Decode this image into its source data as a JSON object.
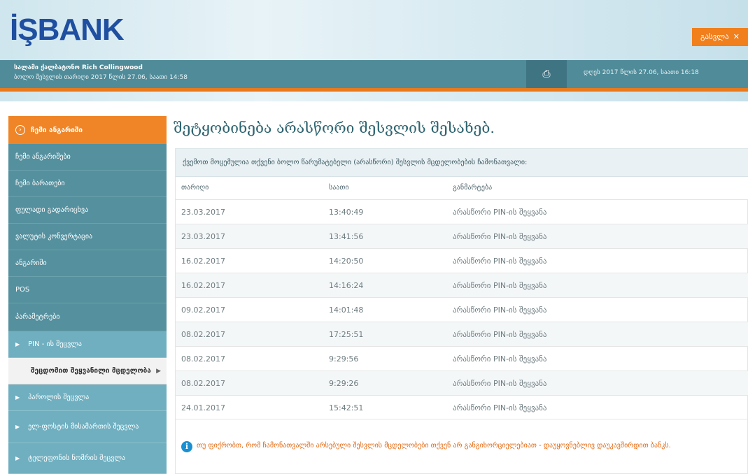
{
  "header": {
    "logo": "İŞBANK",
    "logout_label": "გასვლა",
    "user_line": "სალამი ქალბატონო Rich Collingwood",
    "last_login": "ბოლო შესვლის თარიღი 2017 წლის 27.06, საათი 14:58",
    "date_time": "დღეს 2017 წლის 27.06, საათი 16:18"
  },
  "sidebar": {
    "active": "ჩემი ანგარიში",
    "items": [
      "ჩემი ანგარიშები",
      "ჩემი ბარათები",
      "ფულადი გადარიცხვა",
      "ვალუტის კონვერტაცია",
      "ანგარიში",
      "POS",
      "პარამეტრები"
    ],
    "sub_items": [
      "PIN - ის შეცვლა",
      "შეცდომით შეყვანილი მცდელობა",
      "პაროლის შეცვლა",
      "ელ-ფოსტის მისამართის შეცვლა",
      "ტელეფონის ნომრის შეცვლა"
    ]
  },
  "main": {
    "title": "შეტყობინება არასწორი შესვლის შესახებ.",
    "subtitle": "ქვემოთ მოცემულია თქვენი ბოლო წარუმატებელი (არასწორი) შესვლის მცდელობების ჩამონათვალი:",
    "columns": [
      "თარიღი",
      "საათი",
      "განმარტება"
    ],
    "rows": [
      [
        "23.03.2017",
        "13:40:49",
        "არასწორი PIN-ის შეყვანა"
      ],
      [
        "23.03.2017",
        "13:41:56",
        "არასწორი PIN-ის შეყვანა"
      ],
      [
        "16.02.2017",
        "14:20:50",
        "არასწორი PIN-ის შეყვანა"
      ],
      [
        "16.02.2017",
        "14:16:24",
        "არასწორი PIN-ის შეყვანა"
      ],
      [
        "09.02.2017",
        "14:01:48",
        "არასწორი PIN-ის შეყვანა"
      ],
      [
        "08.02.2017",
        "17:25:51",
        "არასწორი PIN-ის შეყვანა"
      ],
      [
        "08.02.2017",
        "9:29:56",
        "არასწორი PIN-ის შეყვანა"
      ],
      [
        "08.02.2017",
        "9:29:26",
        "არასწორი PIN-ის შეყვანა"
      ],
      [
        "24.01.2017",
        "15:42:51",
        "არასწორი PIN-ის შეყვანა"
      ]
    ],
    "note": "თუ ფიქრობთ, რომ ჩამონათვალში არსებული შესვლის მცდელობები თქვენ არ განგიხორციელებიათ - დაუყოვნებლივ დაუკავშირდით ბანკს."
  }
}
